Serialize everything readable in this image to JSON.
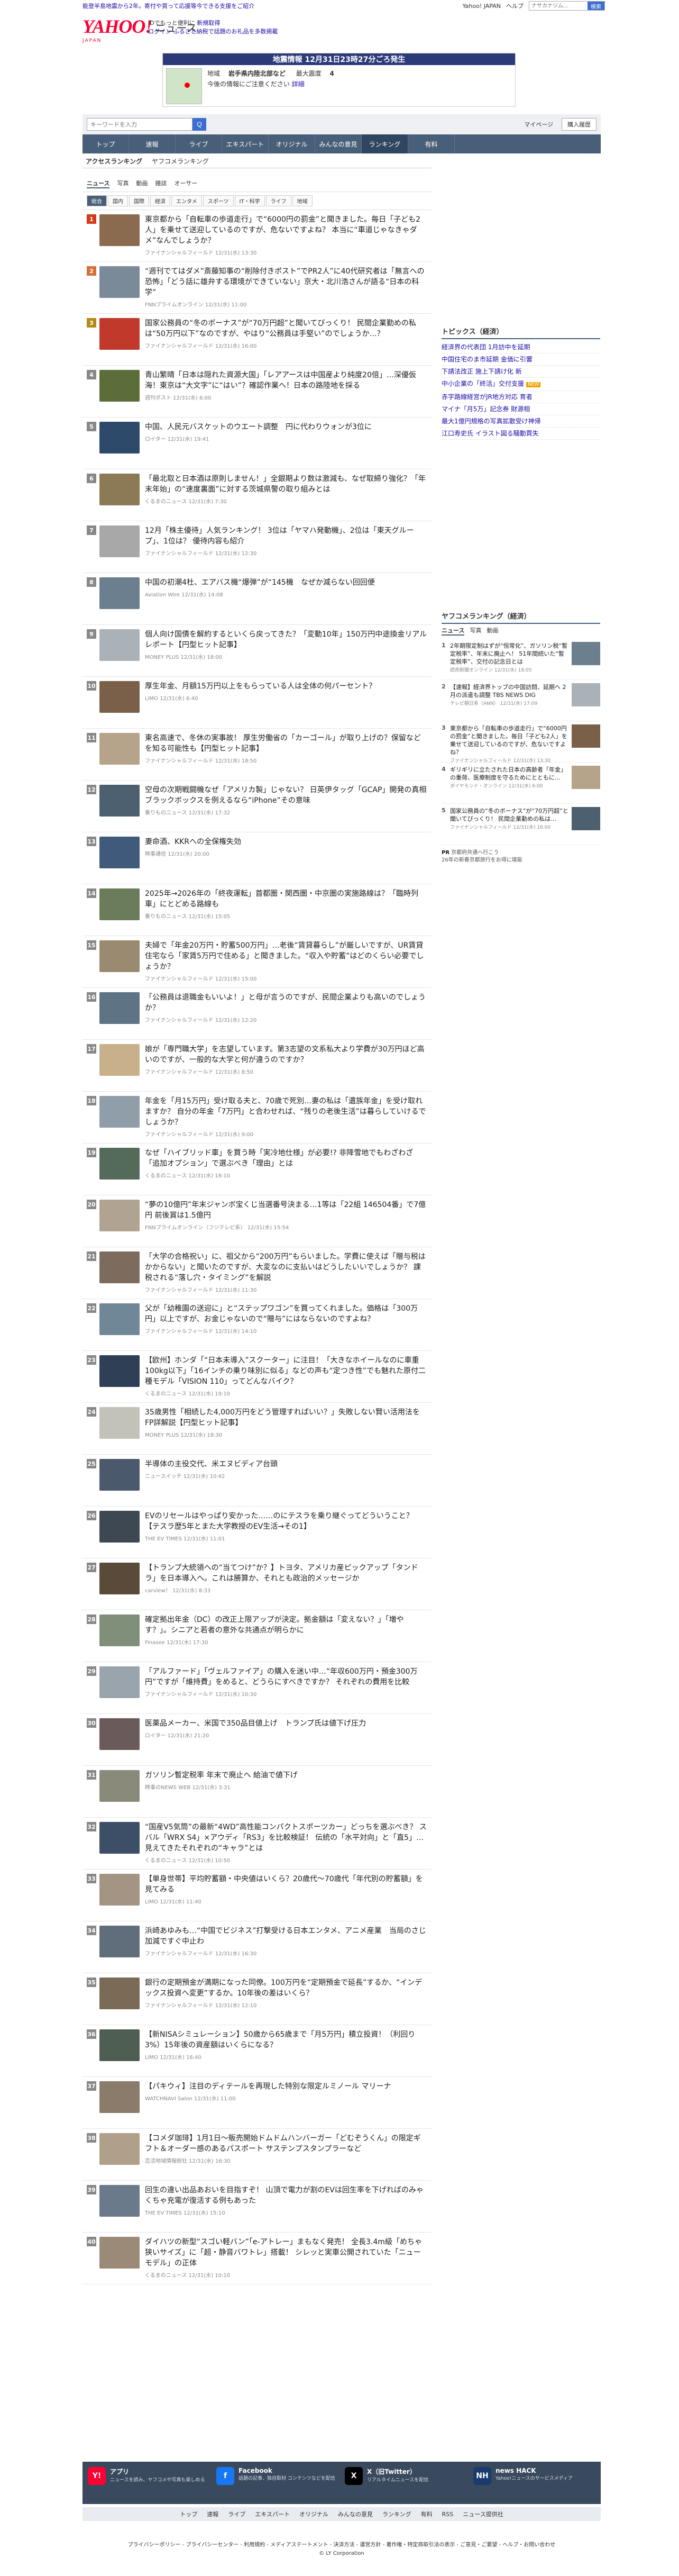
{
  "promo": {
    "left": "能登半島地震から2年。寄付や買って応援等今できる支援をご紹介",
    "links": [
      "Yahoo! JAPAN",
      "ヘルプ"
    ],
    "search_placeholder": "ナサカナジム...",
    "search_button": "検索"
  },
  "header": {
    "logo": "YAHOO!",
    "logo_news": "ニュース",
    "logo_sub": "JAPAN",
    "line1_prefix": "IDでもっと便利に",
    "line1_link": "新規取得",
    "line2_link": "ログイン",
    "line2_text": "ふるさと納税で話題のお礼品を多数掲載"
  },
  "quake": {
    "title": "地震情報 12月31日23時27分ごろ発生",
    "area_label": "地域",
    "area_value": "岩手県内陸北部など",
    "intensity_label": "最大震度",
    "intensity_value": "4",
    "note": "今後の情報にご注意ください",
    "note_link": "詳細"
  },
  "search": {
    "placeholder": "キーワードを入力",
    "button": "Q",
    "mypage": "マイページ",
    "login": "購入履歴"
  },
  "gnav": [
    "トップ",
    "速報",
    "ライブ",
    "エキスパート",
    "オリジナル",
    "みんなの意見",
    "ランキング",
    "有料"
  ],
  "subnav": [
    "アクセスランキング",
    "ヤフコメランキング"
  ],
  "cat_tabs": [
    "ニュース",
    "写真",
    "動画",
    "雑誌",
    "オーサー"
  ],
  "genre_tabs": [
    "総合",
    "国内",
    "国際",
    "経済",
    "エンタメ",
    "スポーツ",
    "IT・科学",
    "ライフ",
    "地域"
  ],
  "ranking": [
    {
      "rank": "1",
      "title": "東京都から「自転車の歩道走行」で“6000円の罰金”と聞きました。毎日「子ども2人」を乗せて送迎しているのですが、危ないですよね？ 本当に“車道じゃなきゃダメ”なんでしょうか？",
      "meta": "ファイナンシャルフィールド 12/31(水) 13:30"
    },
    {
      "rank": "2",
      "title": "“週刊でてはダメ”斎藤知事の“削除付きポスト”でPR2人”に40代研究者は「無言への恐怖」「どう話に雄弁する環境ができていない」京大・北川浩さんが語る“日本の科学”",
      "meta": "FNNプライムオンライン 12/31(水) 11:00"
    },
    {
      "rank": "3",
      "title": "国家公務員の“冬のボーナス”が“70万円超”と聞いてびっくり！ 民間企業勤めの私は“50万円以下”なのですが、やはり“公務員は手堅い”のでしょうか…？",
      "meta": "ファイナンシャルフィールド 12/31(水) 16:00"
    },
    {
      "rank": "4",
      "title": "青山繁晴「日本は隠れた資源大国」「レアアースは中国産より純度20倍」…深優仮海！東京は“大文字”に“はい”？確認作業へ！日本の路陸地を採る",
      "meta": "週刊ポスト 12/31(水) 6:00"
    },
    {
      "rank": "5",
      "title": "中国、人民元バスケットのウエート調整　円に代わりウォンが3位に",
      "meta": "ロイター 12/31(水) 19:41"
    },
    {
      "rank": "6",
      "title": "「最北取と日本酒は原則しません！」全銀期より数は激減も、なぜ取締り強化？「年末年始」の“速度裏面”に対する茨城県警の取り組みとは",
      "meta": "くるまのニュース 12/31(水) 7:30"
    },
    {
      "rank": "7",
      "title": "12月「株主優待」人気ランキング！ 3位は「ヤマハ発動機」、2位は「東天グループ」、1位は？ 優待内容も紹介",
      "meta": "ファイナンシャルフィールド 12/31(水) 12:30"
    },
    {
      "rank": "8",
      "title": "中国の初潮4杜、エアバス機“爆弾”が“145機　なぜか減らない回回便",
      "meta": "Aviation Wire 12/31(水) 14:08"
    },
    {
      "rank": "9",
      "title": "個人向け国債を解約するといくら戻ってきた？「変動10年」150万円中途換金リアルレポート【円型ヒット記事】",
      "meta": "MONEY PLUS 12/31(水) 18:00"
    },
    {
      "rank": "10",
      "title": "厚生年金、月額15万円以上をもらっている人は全体の何パーセント？",
      "meta": "LIMO 12/31(水) 6:40"
    },
    {
      "rank": "11",
      "title": "東名高速で、冬休の実事故！ 厚生労働省の「カーゴール」が取り上げの？保留などを知る可能性も【円型ヒット記事】",
      "meta": "ファイナンシャルフィールド 12/31(水) 18:50"
    },
    {
      "rank": "12",
      "title": "空母の次期戦闘機なぜ「アメリカ製」じゃない？ 日英伊タッグ「GCAP」開発の真相 ブラックボックスを例えるなら“iPhone”その意味",
      "meta": "乗りものニュース 12/31(水) 17:32"
    },
    {
      "rank": "13",
      "title": "妻命酒、KKRへの全保権失効",
      "meta": "時事通信 12/31(水) 20:00"
    },
    {
      "rank": "14",
      "title": "2025年→2026年の「終夜運転」首都圏・関西圏・中京圏の実施路線は？「臨時列車」にとどめる路線も",
      "meta": "乗りものニュース 12/31(水) 15:05"
    },
    {
      "rank": "15",
      "title": "夫婦で「年金20万円・貯蓄500万円」…老後“賃貸暮らし”が厳しいですが、UR賃貸住宅なら「家賃5万円で住める」と聞きました。“収入や貯蓄”はどのくらい必要でしょうか？",
      "meta": "ファイナンシャルフィールド 12/31(水) 15:00"
    },
    {
      "rank": "16",
      "title": "「公務員は退職金もいいよ！」と母が言うのですが、民間企業よりも高いのでしょうか？",
      "meta": "ファイナンシャルフィールド 12/31(水) 12:20"
    },
    {
      "rank": "17",
      "title": "娘が「専門職大学」を志望しています。第3志望の文系私大より学費が30万円ほど高いのですが、一般的な大学と何が違うのですか？",
      "meta": "ファイナンシャルフィールド 12/31(水) 8:50"
    },
    {
      "rank": "18",
      "title": "年金を「月15万円」受け取る夫と、70歳で死別…妻の私は「遺族年金」を受け取れますか？ 自分の年金「7万円」と合わせれば、“残りの老後生活”は暮らしていけるでしょうか？",
      "meta": "ファイナンシャルフィールド 12/31(水) 9:00"
    },
    {
      "rank": "19",
      "title": "なぜ「ハイブリッド車」を買う時「実冷地仕様」が必要!? 非降雪地でもわざわざ「追加オプション」で選ぶべき「理由」とは",
      "meta": "くるまのニュース 12/31(水) 18:10"
    },
    {
      "rank": "20",
      "title": "“夢の10億円”年末ジャンボ宝くじ当選番号決まる…1等は「22組 146504番」で7億円 前後賞は1.5億円",
      "meta": "FNNプライムオンライン（フジテレビ系） 12/31(水) 15:54"
    },
    {
      "rank": "21",
      "title": "「大学の合格祝い」に、祖父から“200万円”もらいました。学費に使えば「贈与税はかからない」と聞いたのですが、大変なのに支払いはどうしたいいでしょうか？ 課税される“落し穴・タイミング”を解説",
      "meta": "ファイナンシャルフィールド 12/31(水) 11:30"
    },
    {
      "rank": "22",
      "title": "父が「幼稚園の送迎に」と“ステップワゴン”を買ってくれました。価格は「300万円」以上ですが、お金じゃないので“贈与”にはならないのですよね？",
      "meta": "ファイナンシャルフィールド 12/31(水) 14:10"
    },
    {
      "rank": "23",
      "title": "【欧州】ホンダ「“日本未導入”スクーター」に注目！「大きなホイールなのに車重100kg以下」「16インチの乗り味別に似る」などの声も“定つき性”でも魅れた原付二種モデル「VISION 110」ってどんなバイク？",
      "meta": "くるまのニュース 12/31(水) 19:10"
    },
    {
      "rank": "24",
      "title": "35歳男性「相続した4,000万円をどう管理すればいい？」失敗しない賢い活用法をFP詳解説【円型ヒット記事】",
      "meta": "MONEY PLUS 12/31(水) 18:30"
    },
    {
      "rank": "25",
      "title": "半導体の主役交代、米エヌビディア台頭",
      "meta": "ニュースイッチ 12/31(水) 10:42"
    },
    {
      "rank": "26",
      "title": "EVのリセールはやっぱり安かった……のにテスラを乗り継ぐってどういうこと？【テスラ歴5年とまた大学教授のEV生活→その1】",
      "meta": "THE EV TIMES 12/31(水) 11:01"
    },
    {
      "rank": "27",
      "title": "【トランプ大統領への“当てつけ”か？】トヨタ、アメリカ産ピックアップ「タンドラ」を日本導入へ。これは勝算か、それとも政治的メッセージか",
      "meta": "carview！ 12/31(水) 8:33"
    },
    {
      "rank": "28",
      "title": "確定拠出年金（DC）の改正上限アップが決定。拠金額は「変えない？」「増やす？」。シニアと若者の意外な共通点が明らかに",
      "meta": "Finasee 12/31(水) 17:30"
    },
    {
      "rank": "29",
      "title": "「アルファード」「ヴェルファイア」の購入を迷い中…“年収600万円・預金300万円”ですが「維持費」をめると、どうらにすべきですか？ それぞれの費用を比較",
      "meta": "ファイナンシャルフィールド 12/31(水) 10:30"
    },
    {
      "rank": "30",
      "title": "医薬品メーカー、米国で350品目値上げ　トランプ氏は値下げ圧力",
      "meta": "ロイター 12/31(水) 21:20"
    },
    {
      "rank": "31",
      "title": "ガソリン暫定税率 年末で廃止へ 給油で値下げ",
      "meta": "時事の​NEWS WEB 12/31(水) 3:31"
    },
    {
      "rank": "32",
      "title": "“国産V5気筒”の最新“4WD”高性能コンパクトスポーツカー」どっちを選ぶべき？ スバル「WRX S4」×アウディ「RS3」を比較検証！ 伝統の「水平対向」と「直5」…見えてきたそれぞれの“キャラ”とは",
      "meta": "くるまのニュース 12/31(水) 10:50"
    },
    {
      "rank": "33",
      "title": "【単身世帯】平均貯蓄額・中央値はいくら？20歳代〜70歳代「年代別の貯蓄額」を見てみる",
      "meta": "LIMO 12/31(水) 11:40"
    },
    {
      "rank": "34",
      "title": "浜崎あゆみも…“中国でビジネス”打撃受ける日本エンタメ、アニメ産業　当局のさじ加減ですぐ中止わ",
      "meta": "ファイナンシャルフィールド 12/31(水) 16:30"
    },
    {
      "rank": "35",
      "title": "銀行の定期預金が満期になった同僚。100万円を“定期預金で延長”するか、“インデックス投資へ変更”するか。10年後の差はいくら？",
      "meta": "ファイナンシャルフィールド 12/31(水) 12:10"
    },
    {
      "rank": "36",
      "title": "【新NISAシミュレーション】50歳から65歳まで「月5万円」積立投資！（利回り3%）15年後の資産額はいくらになる？",
      "meta": "LIMO 12/31(水) 16:40"
    },
    {
      "rank": "37",
      "title": "【パキウィ】注目のディテールを再現した特別な限定ルミノール マリーナ",
      "meta": "WATCHNAVI Salon 12/31(水) 11:00"
    },
    {
      "rank": "38",
      "title": "【コメダ珈琲】1月1日〜販売開始ドムドムハンバーガー「どむぞうくん」の限定ギフト＆オーダー感のあるパスポート サステンプスタンプラーなど",
      "meta": "恋活地域情報総社 12/31(水) 16:30"
    },
    {
      "rank": "39",
      "title": "回生の違い出品あおいを目指すぞ！ 山頂で電力が割のEVは回生率を下げればのみゃくちゃ充電が復活する例もあった",
      "meta": "THE EV TIMES 12/31(水) 15:10"
    },
    {
      "rank": "40",
      "title": "ダイハツの新型“スゴい軽バン”「e-アトレー」まもなく発売！ 全長3.4m級「めちゃ狭いサイズ」に「超・静音バワトレ」搭載！ シレッと実車公開されていた「ニューモデル」の正体",
      "meta": "くるまのニュース 12/31(水) 10:10"
    }
  ],
  "topics": {
    "heading": "トピックス（経済）",
    "items": [
      {
        "title": "経済界の代表団 1月訪中を延期",
        "badge": ""
      },
      {
        "title": "中国住宅のま市延期 金価に引響",
        "badge": ""
      },
      {
        "title": "下請法改正 施上下請け化 新",
        "badge": ""
      },
      {
        "title": "中小企業の「終活」交付支援",
        "badge": "NEW"
      },
      {
        "title": "赤字路線経営がJR地方対応 育者",
        "badge": ""
      },
      {
        "title": "マイナ「月5万」記念券 財源相",
        "badge": ""
      },
      {
        "title": "最大1億円規格の写真拡散受け神帰",
        "badge": ""
      },
      {
        "title": "江口寿史氏 イラスト図る騒動買失",
        "badge": ""
      }
    ]
  },
  "side_rank": {
    "heading": "ヤフコメランキング（経済）",
    "tabs": [
      "ニュース",
      "写真",
      "動画"
    ],
    "items": [
      {
        "rank": "1",
        "title": "2年期限定制はずが“恒常化”、ガソリン税“暫定税率”、年末に廃止へ！ 51年間続いた“暫定税率”、交付の記念日とは",
        "meta": "読売新聞オンライン 12/31(水) 18:05"
      },
      {
        "rank": "2",
        "title": "【速報】経済界トップの中国訪問、延期へ 2月の派遣も調整 TBS NEWS DIG",
        "meta": "テレビ朝日系（ANN） 12/31(水) 17:09"
      },
      {
        "rank": "3",
        "title": "東京都から「自転車の歩道走行」で“6000円の罰金”と聞きました。毎日「子ども2人」を乗せて送迎しているのですが、危ないですよね？",
        "meta": "ファイナンシャルフィールド 12/31(水) 13:30"
      },
      {
        "rank": "4",
        "title": "ギリギリに立たされた日本の高齢者「年金」の重荷、医療制度を守るためにとともに…",
        "meta": "ダイヤモンド・オンライン 12/31(水) 6:00"
      },
      {
        "rank": "5",
        "title": "国家公務員の“冬のボーナス”が“70万円超”と聞いてびっくり！ 民間企業勤めの私は…",
        "meta": "ファイナンシャルフィールド 12/31(水) 16:00"
      }
    ],
    "pr_label": "PR",
    "pr_title": "京都府共通へ行こう",
    "pr_text": "26年の新春京都旅行をお得に堪能"
  },
  "apps": [
    {
      "name": "アプリ",
      "desc": "ニュースを読み、ヤフコメや写真も楽しめる",
      "icon": "Y!",
      "color": "#ff0033"
    },
    {
      "name": "Facebook",
      "desc": "話題の記事、独自取材 コンテンツなどを配信",
      "icon": "f",
      "color": "#1877f2"
    },
    {
      "name": "X（旧Twitter）",
      "desc": "リアルタイムニュースを配信",
      "icon": "X",
      "color": "#000000"
    },
    {
      "name": "news HACK",
      "desc": "Yahoo!ニュースのサービスメディア",
      "icon": "NH",
      "color": "#1a3b6e"
    }
  ],
  "footer_nav": [
    "トップ",
    "速報",
    "ライブ",
    "エキスパート",
    "オリジナル",
    "みんなの意見",
    "ランキング",
    "有料",
    "RSS",
    "ニュース提供社"
  ],
  "footer_links": "プライバシーポリシー - プライバシーセンター - 利用規約 - メディアステートメント - 決済方法 - 運営方針 - 著作権・特定商取引法の表示 - ご意見・ご要望 - ヘルプ・お問い合わせ",
  "copyright": "© LY Corporation",
  "thumb_colors": [
    "#8a6b4f",
    "#7b8a99",
    "#c0392b",
    "#5b6e3a",
    "#2e4a6b",
    "#8c7a56",
    "#a8a8a8",
    "#6b7f8e",
    "#aab2b8",
    "#7a6048",
    "#b5a38a",
    "#4c6070",
    "#3f5a7a",
    "#6a7c5a",
    "#9a8a70",
    "#5e7383",
    "#c7b08a",
    "#8f9ea8",
    "#556b5a",
    "#b0a392",
    "#7d6c5d",
    "#6f8796",
    "#2f3f55",
    "#c2c2b8",
    "#4a5a6c",
    "#3e4852",
    "#5a4a3a",
    "#7f8f7a",
    "#9aa4ad",
    "#6b5a5a",
    "#8a8a7a",
    "#3d4f66",
    "#a39483",
    "#5f6e7a",
    "#7b6a55",
    "#4e5e52",
    "#8a7b6b",
    "#b0a08a",
    "#6a7a8a",
    "#9c8a78"
  ]
}
